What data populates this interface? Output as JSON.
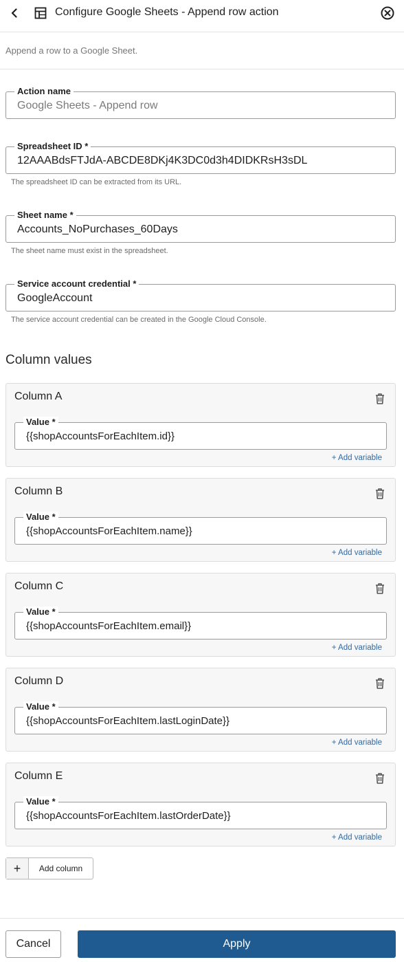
{
  "header": {
    "title": "Configure Google Sheets - Append row action",
    "back_icon": "chevron-left-icon",
    "app_icon": "table-icon",
    "close_icon": "close-circle-icon"
  },
  "subtitle": "Append a row to a Google Sheet.",
  "fields": {
    "action_name": {
      "label": "Action name",
      "placeholder": "Google Sheets - Append row"
    },
    "spreadsheet_id": {
      "label": "Spreadsheet ID *",
      "value": "12AAABdsFTJdA-ABCDE8DKj4K3DC0d3h4DIDKRsH3sDL",
      "hint": "The spreadsheet ID can be extracted from its URL."
    },
    "sheet_name": {
      "label": "Sheet name *",
      "value": "Accounts_NoPurchases_60Days",
      "hint": "The sheet name must exist in the spreadsheet."
    },
    "credential": {
      "label": "Service account credential *",
      "value": "GoogleAccount",
      "hint": "The service account credential can be created in the Google Cloud Console."
    }
  },
  "column_values": {
    "title": "Column values",
    "value_label": "Value *",
    "add_variable_label": "+ Add variable",
    "columns": [
      {
        "title": "Column A",
        "value": "{{shopAccountsForEachItem.id}}"
      },
      {
        "title": "Column B",
        "value": "{{shopAccountsForEachItem.name}}"
      },
      {
        "title": "Column C",
        "value": "{{shopAccountsForEachItem.email}}"
      },
      {
        "title": "Column D",
        "value": "{{shopAccountsForEachItem.lastLoginDate}}"
      },
      {
        "title": "Column E",
        "value": "{{shopAccountsForEachItem.lastOrderDate}}"
      }
    ],
    "add_column_label": "Add column",
    "add_column_icon": "+"
  },
  "footer": {
    "cancel_label": "Cancel",
    "apply_label": "Apply",
    "apply_color": "#1f5a91"
  }
}
